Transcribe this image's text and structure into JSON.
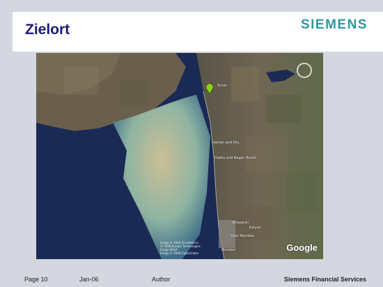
{
  "header": {
    "title": "Zielort",
    "brand": "SIEMENS"
  },
  "map": {
    "provider_logo": "Google",
    "copyright_lines": [
      "Image © 2008 TerraMetrics",
      "© 2008 Europa Technologies",
      "Image NASA",
      "Image © 2008 DigitalGlobe"
    ],
    "places": {
      "surat": "Surat",
      "daman_diu": "Daman and Diu",
      "dadra": "Dadra and Nagar Haveli",
      "bhiwandi": "Bhiwandi",
      "kalyan": "Kalyan",
      "navi_mumbai": "Navi Mumbai",
      "mumbai": "Mumbai"
    },
    "icons": {
      "compass": "compass-icon",
      "marker": "location-pin-icon"
    },
    "colors": {
      "sea": "#1b2a55",
      "silt": "#c8b98a",
      "land": "#6e6450"
    }
  },
  "footer": {
    "page": "Page 10",
    "date": "Jan-06",
    "author": "Author",
    "company": "Siemens Financial Services"
  }
}
